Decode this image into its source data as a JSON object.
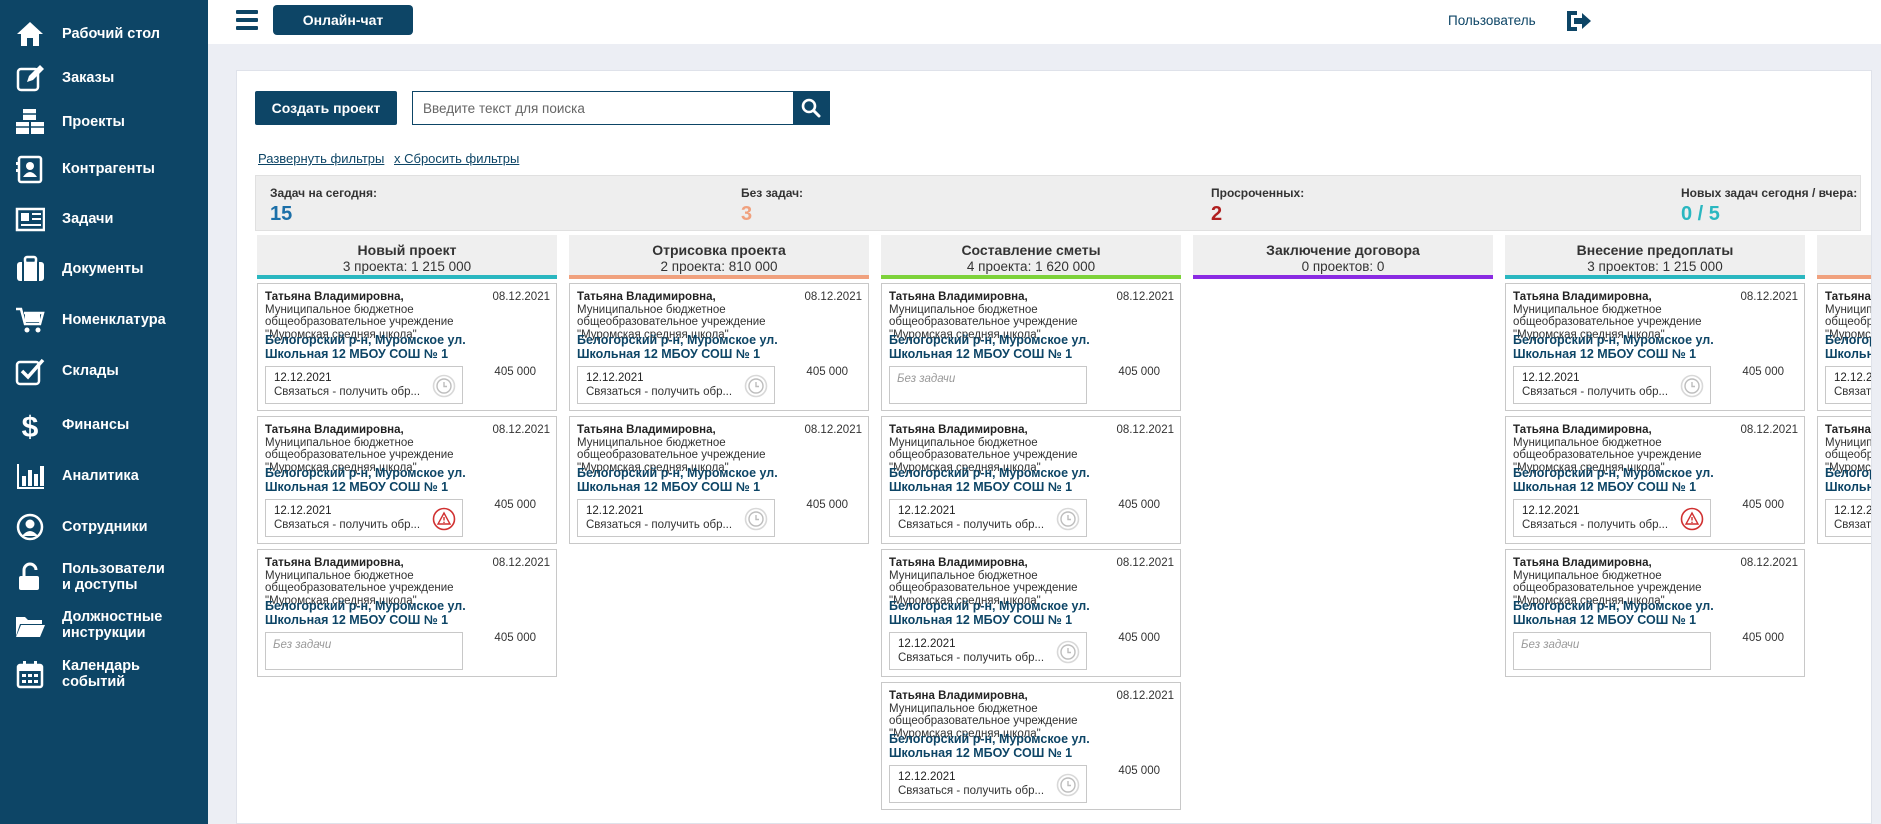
{
  "sidebar": {
    "items": [
      {
        "label": "Рабочий стол",
        "icon": "home-icon"
      },
      {
        "label": "Заказы",
        "icon": "edit-icon"
      },
      {
        "label": "Проекты",
        "icon": "boxes-icon"
      },
      {
        "label": "Контрагенты",
        "icon": "contact-icon"
      },
      {
        "label": "Задачи",
        "icon": "newspaper-icon"
      },
      {
        "label": "Документы",
        "icon": "briefcase-icon"
      },
      {
        "label": "Номенклатура",
        "icon": "cart-icon"
      },
      {
        "label": "Склады",
        "icon": "checkbox-icon"
      },
      {
        "label": "Финансы",
        "icon": "dollar-icon"
      },
      {
        "label": "Аналитика",
        "icon": "bar-chart-icon"
      },
      {
        "label": "Сотрудники",
        "icon": "user-circle-icon"
      },
      {
        "label": "Пользователи\nи доступы",
        "icon": "unlock-icon"
      },
      {
        "label": "Должностные\nинструкции",
        "icon": "folder-icon"
      },
      {
        "label": "Календарь\nсобытий",
        "icon": "calendar-icon"
      }
    ]
  },
  "topbar": {
    "chat_label": "Онлайн-чат",
    "user_label": "Пользователь"
  },
  "toolbar": {
    "create_label": "Создать проект",
    "search_placeholder": "Введите текст для поиска",
    "expand_filters": "Развернуть фильтры",
    "reset_filters": "x Сбросить фильтры"
  },
  "stats": [
    {
      "label": "Задач на сегодня:",
      "value": "15",
      "color": "#1b6fa8"
    },
    {
      "label": "Без задач:",
      "value": "3",
      "color": "#f0a17e"
    },
    {
      "label": "Просроченных:",
      "value": "2",
      "color": "#b02020"
    },
    {
      "label": "Новых задач сегодня / вчера:",
      "value": "0 / 5",
      "color": "#2ab7c0"
    }
  ],
  "card_common": {
    "client_name": "Татьяна Владимировна,",
    "client_org": " Муниципальное бюджетное общеобразовательное учреждение \"Муромская средняя школа\"",
    "date": "08.12.2021",
    "address": "Белогорский р-н, Муромское ул. Школьная 12 МБОУ СОШ № 1",
    "amount": "405 000",
    "task_date": "12.12.2021",
    "task_text": "Связаться - получить обр..."
  },
  "columns": [
    {
      "title": "Новый проект",
      "subtitle": "3 проекта: 1 215 000",
      "color": "#2ab7c0",
      "cards": [
        {
          "task": "normal",
          "status": "clock"
        },
        {
          "task": "normal",
          "status": "warning"
        },
        {
          "task": "none",
          "none_text": "Без задачи"
        }
      ]
    },
    {
      "title": "Отрисовка проекта",
      "subtitle": "2 проекта: 810 000",
      "color": "#f0a17e",
      "cards": [
        {
          "task": "normal",
          "status": "clock"
        },
        {
          "task": "normal",
          "status": "clock"
        }
      ]
    },
    {
      "title": "Составление сметы",
      "subtitle": "4 проекта: 1 620 000",
      "color": "#7dd23a",
      "cards": [
        {
          "task": "none",
          "none_text": "Без задачи"
        },
        {
          "task": "normal",
          "status": "clock"
        },
        {
          "task": "normal",
          "status": "clock"
        },
        {
          "task": "normal",
          "status": "clock"
        }
      ]
    },
    {
      "title": "Заключение договора",
      "subtitle": "0 проектов: 0",
      "color": "#8a2be2",
      "cards": []
    },
    {
      "title": "Внесение предоплаты",
      "subtitle": "3 проектов: 1 215 000",
      "color": "#2ab7c0",
      "cards": [
        {
          "task": "normal",
          "status": "clock"
        },
        {
          "task": "normal",
          "status": "warning"
        },
        {
          "task": "none",
          "none_text": "Без задачи"
        }
      ]
    },
    {
      "title": "",
      "subtitle": "",
      "color": "#f0a17e",
      "cards": [
        {
          "task": "normal",
          "status": "clock"
        },
        {
          "task": "normal",
          "status": "clock"
        }
      ]
    }
  ]
}
